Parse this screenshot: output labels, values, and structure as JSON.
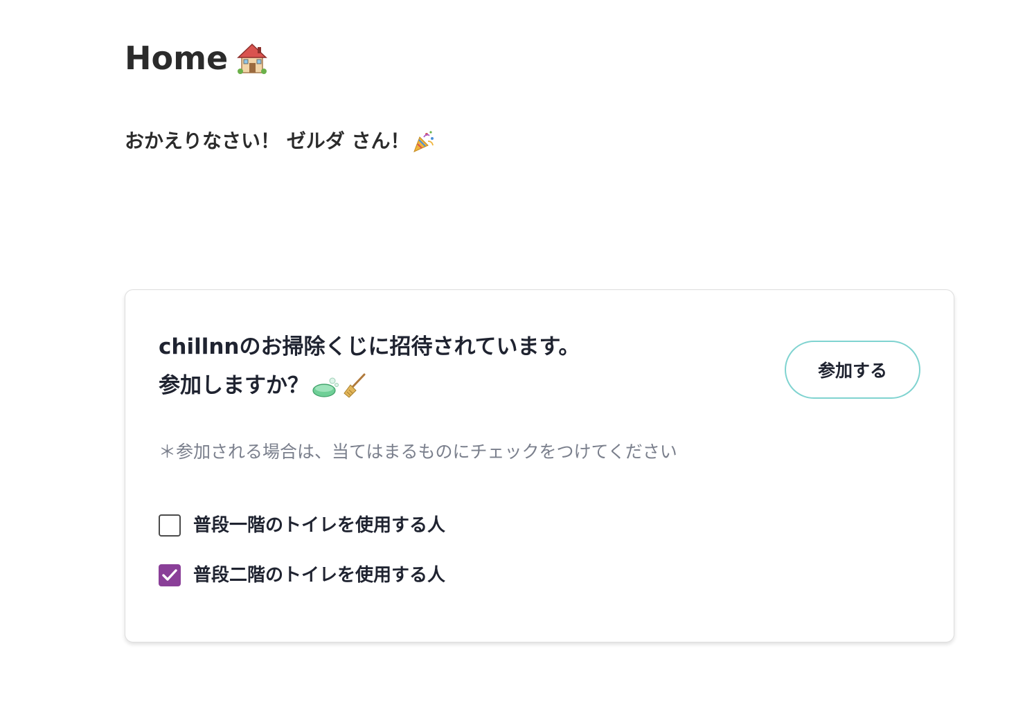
{
  "header": {
    "title": "Home",
    "title_icon": "house-icon"
  },
  "welcome": {
    "text": "おかえりなさい！ ゼルダ さん！",
    "icon": "party-popper-icon"
  },
  "invitation": {
    "heading_line1": "chillnnのお掃除くじに招待されています。",
    "heading_line2": "参加しますか？",
    "heading_icons": [
      "soap-icon",
      "broom-icon"
    ],
    "join_label": "参加する",
    "note": "＊参加される場合は、当てはまるものにチェックをつけてください",
    "options": [
      {
        "label": "普段一階のトイレを使用する人",
        "checked": false
      },
      {
        "label": "普段二階のトイレを使用する人",
        "checked": true
      }
    ]
  },
  "colors": {
    "accent_checkbox": "#8a3f98",
    "button_border": "#7fd3d0",
    "heading_text": "#1f2330",
    "note_text": "#7a7f8c"
  }
}
